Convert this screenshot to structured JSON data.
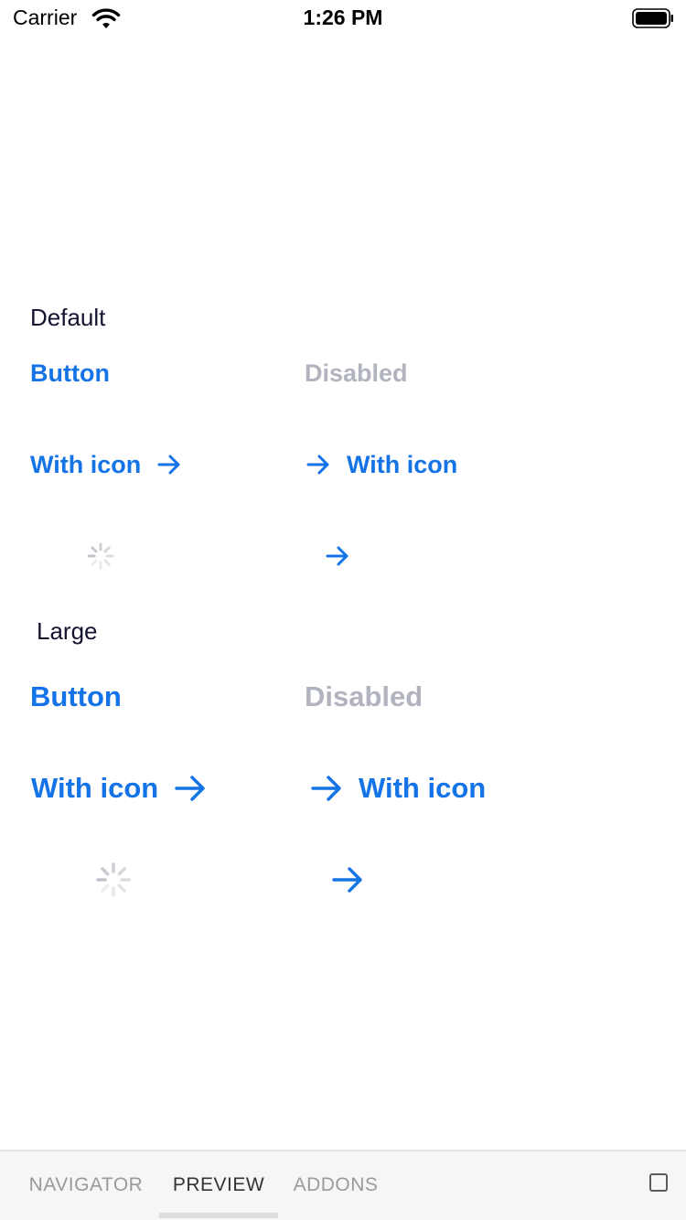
{
  "status_bar": {
    "carrier": "Carrier",
    "time": "1:26 PM",
    "wifi_icon": "wifi-icon",
    "battery_icon": "battery-icon"
  },
  "sections": {
    "default": {
      "label": "Default",
      "button": "Button",
      "disabled": "Disabled",
      "with_icon_right": "With icon",
      "with_icon_left": "With icon"
    },
    "large": {
      "label": "Large",
      "button": "Button",
      "disabled": "Disabled",
      "with_icon_right": "With icon",
      "with_icon_left": "With icon"
    }
  },
  "icons": {
    "arrow": "arrow-right-icon",
    "spinner": "loading-spinner-icon"
  },
  "colors": {
    "primary": "#1473e6",
    "disabled": "#b1b3bf",
    "label": "#141431"
  },
  "tabs": [
    {
      "label": "NAVIGATOR",
      "active": false
    },
    {
      "label": "PREVIEW",
      "active": true
    },
    {
      "label": "ADDONS",
      "active": false
    }
  ]
}
